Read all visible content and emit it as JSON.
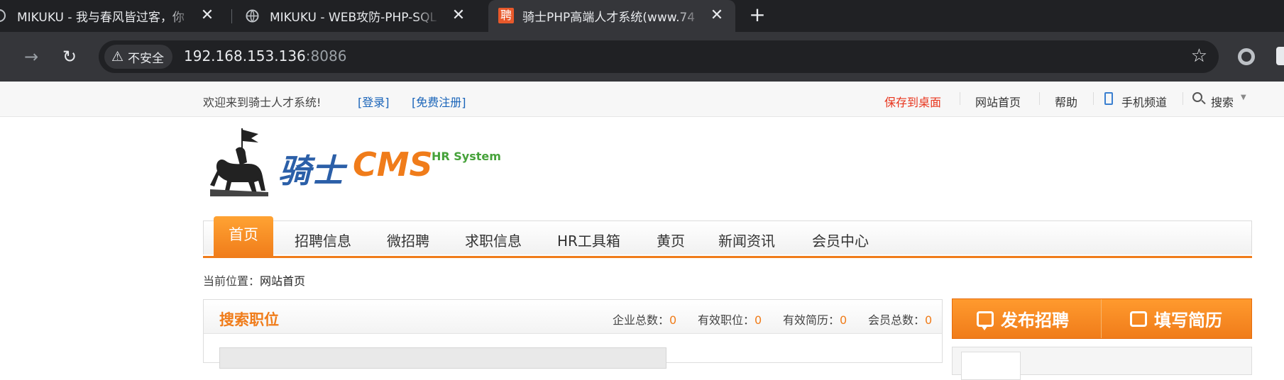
{
  "browser": {
    "tabs": [
      {
        "title": "MIKUKU - 我与春风皆过客，你",
        "active": false
      },
      {
        "title": "MIKUKU - WEB攻防-PHP-SQL",
        "active": false
      },
      {
        "title": "骑士PHP高端人才系统(www.74",
        "active": true,
        "favicon_text": "聘"
      }
    ],
    "close_glyph": "✕",
    "new_tab_glyph": "+",
    "security_label": "不安全",
    "url_host": "192.168.153.136",
    "url_port": ":8086"
  },
  "topbar": {
    "welcome": "欢迎来到骑士人才系统!",
    "login": "[登录]",
    "register": "[免费注册]",
    "save_desktop": "保存到桌面",
    "home": "网站首页",
    "help": "帮助",
    "mobile": "手机频道",
    "search": "搜索"
  },
  "logo": {
    "cn": "骑士",
    "en": "CMS",
    "tagline": "HR System"
  },
  "nav": {
    "home": "首页",
    "items": [
      "招聘信息",
      "微招聘",
      "求职信息",
      "HR工具箱",
      "黄页",
      "新闻资讯",
      "会员中心"
    ]
  },
  "breadcrumb": {
    "prefix": "当前位置：",
    "current": "网站首页"
  },
  "search_panel": {
    "title": "搜索职位",
    "stats": [
      {
        "label": "企业总数：",
        "value": "0"
      },
      {
        "label": "有效职位：",
        "value": "0"
      },
      {
        "label": "有效简历：",
        "value": "0"
      },
      {
        "label": "会员总数：",
        "value": "0"
      }
    ]
  },
  "actions": {
    "post_job": "发布招聘",
    "fill_resume": "填写简历"
  },
  "colors": {
    "accent": "#f07c1a",
    "link": "#1a64b9",
    "save": "#e8341c",
    "logo_blue": "#2b5fa8",
    "logo_green": "#46a23a"
  }
}
